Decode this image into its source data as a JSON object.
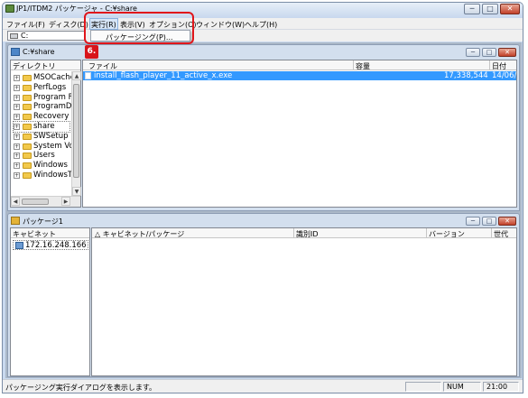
{
  "window": {
    "title": "JP1/ITDM2 パッケージャ - C:¥share",
    "minimize_glyph": "─",
    "maximize_glyph": "□",
    "close_glyph": "✕"
  },
  "menubar": {
    "items": [
      "ファイル(F)",
      "ディスク(D)",
      "実行(R)",
      "表示(V)",
      "オプション(O)",
      "ウィンドウ(W)",
      "ヘルプ(H)"
    ]
  },
  "dropdown": {
    "item": "パッケージング(P)..."
  },
  "callout": {
    "label": "6."
  },
  "toolbar": {
    "drive_value": "C:",
    "drive_icon": "drive-icon"
  },
  "explorer": {
    "title": "C:¥share",
    "directory_header": "ディレクトリ",
    "folders": [
      {
        "label": "MSOCache",
        "expander": "+"
      },
      {
        "label": "PerfLogs",
        "expander": "+"
      },
      {
        "label": "Program Fi",
        "expander": "+"
      },
      {
        "label": "ProgramDa",
        "expander": "+"
      },
      {
        "label": "Recovery",
        "expander": "+"
      },
      {
        "label": "share",
        "expander": "+"
      },
      {
        "label": "SWSetup",
        "expander": "+"
      },
      {
        "label": "System Vo",
        "expander": "+"
      },
      {
        "label": "Users",
        "expander": "+"
      },
      {
        "label": "Windows",
        "expander": "+"
      },
      {
        "label": "WindowsTe",
        "expander": "+"
      }
    ],
    "columns": [
      "ファイル",
      "容量",
      "日付"
    ],
    "files": [
      {
        "name": "install_flash_player_11_active_x.exe",
        "size": "17,338,544",
        "date": "14/06/"
      }
    ]
  },
  "package_window": {
    "title": "パッケージ1",
    "cabinet_header": "キャビネット",
    "cabinet_ip": "172.16.248.166",
    "columns": [
      "△ キャビネット/パッケージ",
      "識別ID",
      "バージョン",
      "世代"
    ]
  },
  "statusbar": {
    "message": "パッケージング実行ダイアログを表示します。",
    "num": "NUM",
    "time": "21:00"
  },
  "colors": {
    "highlight_red": "#e0161b",
    "selection_blue": "#3399ff"
  }
}
